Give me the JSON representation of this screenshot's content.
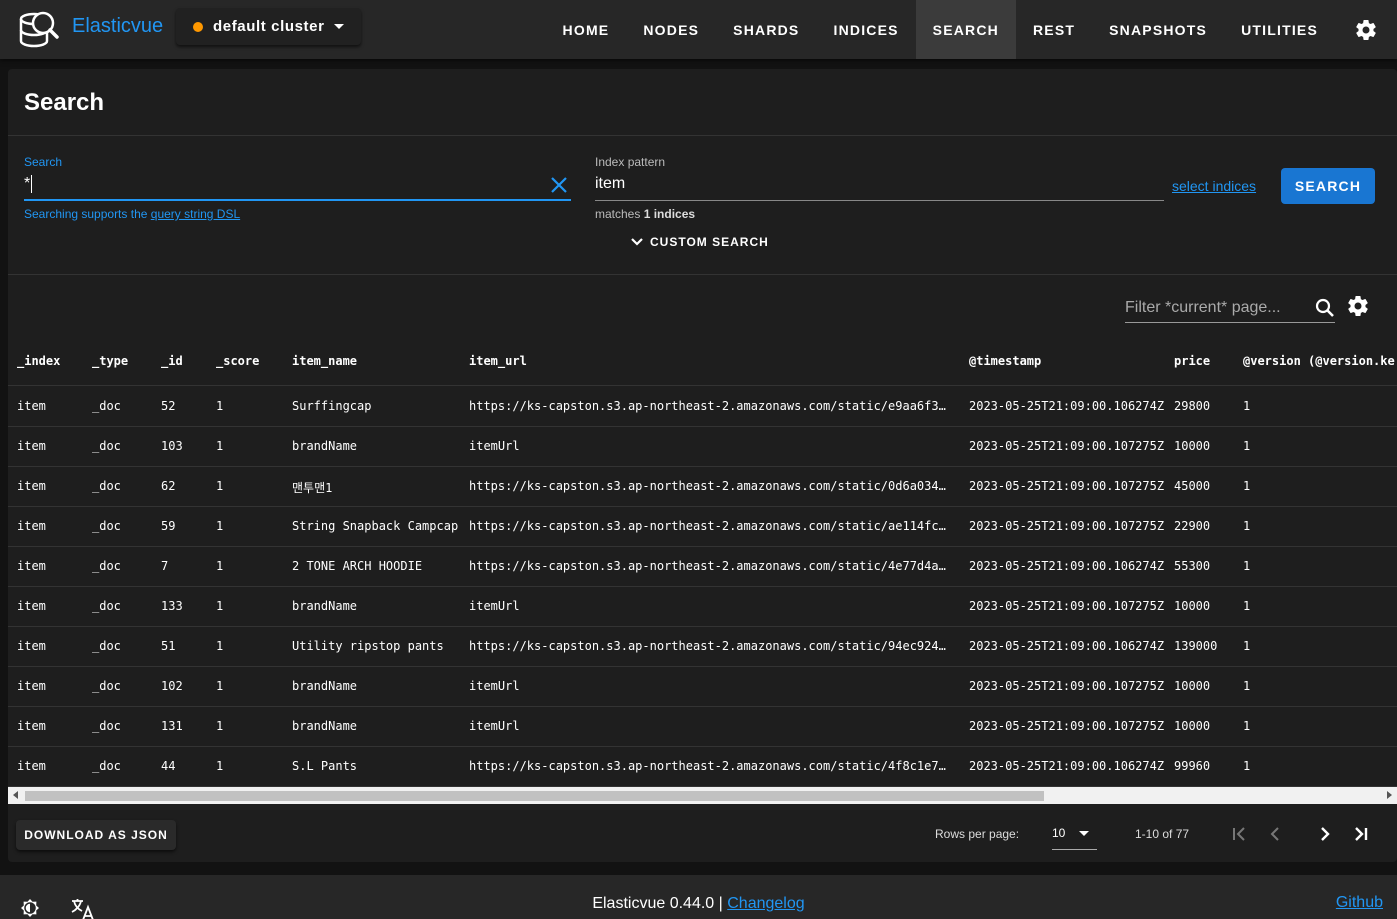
{
  "app": {
    "name": "Elasticvue",
    "cluster": "default cluster",
    "cluster_status_color": "#ff9800",
    "accent_color": "#2196f3"
  },
  "nav": {
    "items": [
      "HOME",
      "NODES",
      "SHARDS",
      "INDICES",
      "SEARCH",
      "REST",
      "SNAPSHOTS",
      "UTILITIES"
    ],
    "active": "SEARCH",
    "settings_icon": "gear-icon"
  },
  "search": {
    "title": "Search",
    "label": "Search",
    "value": "*",
    "hint_prefix": "Searching supports the",
    "hint_link": "query string DSL",
    "index_label": "Index pattern",
    "index_value": "item",
    "matches_prefix": "matches",
    "matches_count": "1 indices",
    "select_indices": "select indices",
    "button": "SEARCH",
    "custom_search": "CUSTOM SEARCH"
  },
  "results": {
    "filter_placeholder": "Filter *current* page...",
    "columns": [
      "_index",
      "_type",
      "_id",
      "_score",
      "item_name",
      "item_url",
      "@timestamp",
      "price",
      "@version (@version.ke"
    ],
    "rows": [
      [
        "item",
        "_doc",
        "52",
        "1",
        "Surffingcap",
        "https://ks-capston.s3.ap-northeast-2.amazonaws.com/static/e9aa6f31-…",
        "2023-05-25T21:09:00.106274Z",
        "29800",
        "1"
      ],
      [
        "item",
        "_doc",
        "103",
        "1",
        "brandName",
        "itemUrl",
        "2023-05-25T21:09:00.107275Z",
        "10000",
        "1"
      ],
      [
        "item",
        "_doc",
        "62",
        "1",
        "맨투맨1",
        "https://ks-capston.s3.ap-northeast-2.amazonaws.com/static/0d6a0348-…",
        "2023-05-25T21:09:00.107275Z",
        "45000",
        "1"
      ],
      [
        "item",
        "_doc",
        "59",
        "1",
        "String Snapback Campcap",
        "https://ks-capston.s3.ap-northeast-2.amazonaws.com/static/ae114fc0-…",
        "2023-05-25T21:09:00.107275Z",
        "22900",
        "1"
      ],
      [
        "item",
        "_doc",
        "7",
        "1",
        "2 TONE ARCH HOODIE",
        "https://ks-capston.s3.ap-northeast-2.amazonaws.com/static/4e77d4ae-…",
        "2023-05-25T21:09:00.106274Z",
        "55300",
        "1"
      ],
      [
        "item",
        "_doc",
        "133",
        "1",
        "brandName",
        "itemUrl",
        "2023-05-25T21:09:00.107275Z",
        "10000",
        "1"
      ],
      [
        "item",
        "_doc",
        "51",
        "1",
        "Utility ripstop pants",
        "https://ks-capston.s3.ap-northeast-2.amazonaws.com/static/94ec924a-…",
        "2023-05-25T21:09:00.106274Z",
        "139000",
        "1"
      ],
      [
        "item",
        "_doc",
        "102",
        "1",
        "brandName",
        "itemUrl",
        "2023-05-25T21:09:00.107275Z",
        "10000",
        "1"
      ],
      [
        "item",
        "_doc",
        "131",
        "1",
        "brandName",
        "itemUrl",
        "2023-05-25T21:09:00.107275Z",
        "10000",
        "1"
      ],
      [
        "item",
        "_doc",
        "44",
        "1",
        "S.L Pants",
        "https://ks-capston.s3.ap-northeast-2.amazonaws.com/static/4f8c1e7e-…",
        "2023-05-25T21:09:00.106274Z",
        "99960",
        "1"
      ]
    ],
    "download": "DOWNLOAD AS JSON",
    "rows_per_page_label": "Rows per page:",
    "rows_per_page": "10",
    "range": "1-10 of 77"
  },
  "footer": {
    "version": "Elasticvue 0.44.0",
    "separator": "|",
    "changelog": "Changelog",
    "github": "Github"
  }
}
